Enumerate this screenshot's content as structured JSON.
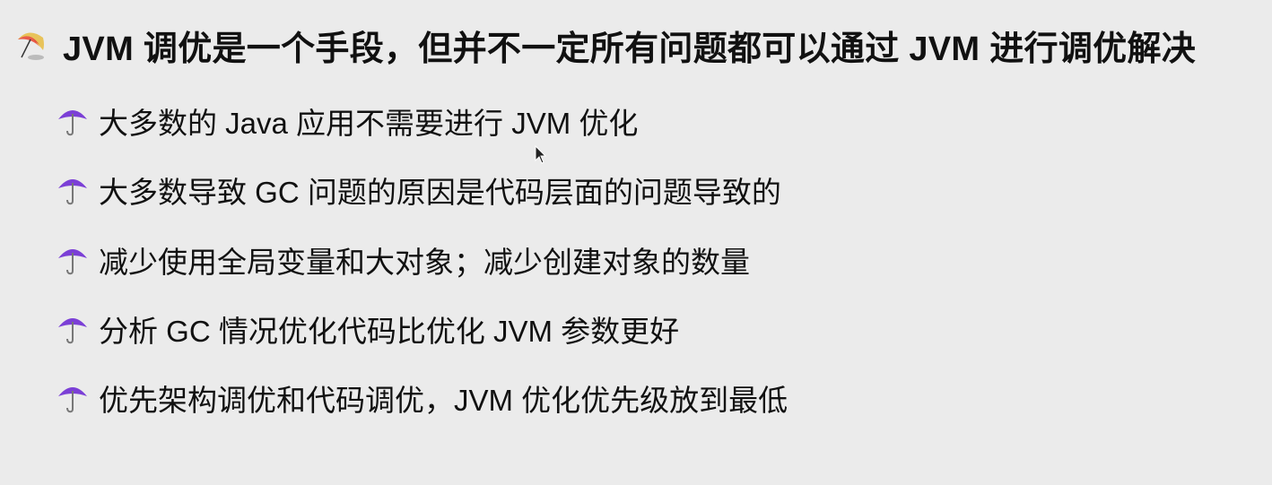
{
  "title": {
    "icon": "beach-umbrella-icon",
    "text": "JVM 调优是一个手段，但并不一定所有问题都可以通过 JVM 进行调优解决"
  },
  "items": [
    {
      "icon": "umbrella-icon",
      "text": "大多数的 Java 应用不需要进行 JVM 优化"
    },
    {
      "icon": "umbrella-icon",
      "text": "大多数导致 GC 问题的原因是代码层面的问题导致的"
    },
    {
      "icon": "umbrella-icon",
      "text": "减少使用全局变量和大对象；减少创建对象的数量"
    },
    {
      "icon": "umbrella-icon",
      "text": "分析 GC 情况优化代码比优化 JVM 参数更好"
    },
    {
      "icon": "umbrella-icon",
      "text": "优先架构调优和代码调优，JVM 优化优先级放到最低"
    }
  ]
}
